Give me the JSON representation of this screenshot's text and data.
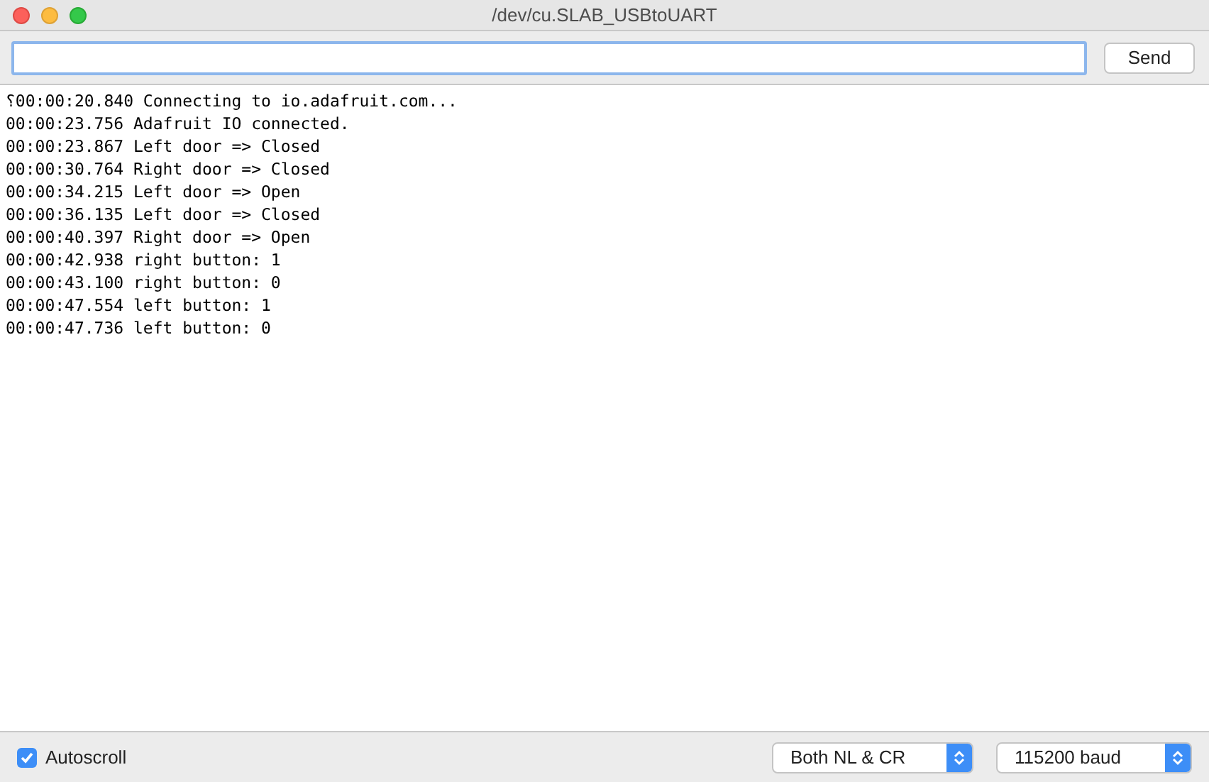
{
  "window": {
    "title": "/dev/cu.SLAB_USBtoUART"
  },
  "send_button": "Send",
  "log_lines": [
    "⸮00:00:20.840 Connecting to io.adafruit.com...",
    "00:00:23.756 Adafruit IO connected.",
    "00:00:23.867 Left door => Closed",
    "00:00:30.764 Right door => Closed",
    "00:00:34.215 Left door => Open",
    "00:00:36.135 Left door => Closed",
    "00:00:40.397 Right door => Open",
    "00:00:42.938 right button: 1",
    "00:00:43.100 right button: 0",
    "00:00:47.554 left button: 1",
    "00:00:47.736 left button: 0"
  ],
  "autoscroll": {
    "label": "Autoscroll",
    "checked": true
  },
  "line_ending": {
    "value": "Both NL & CR"
  },
  "baud_rate": {
    "value": "115200 baud"
  }
}
